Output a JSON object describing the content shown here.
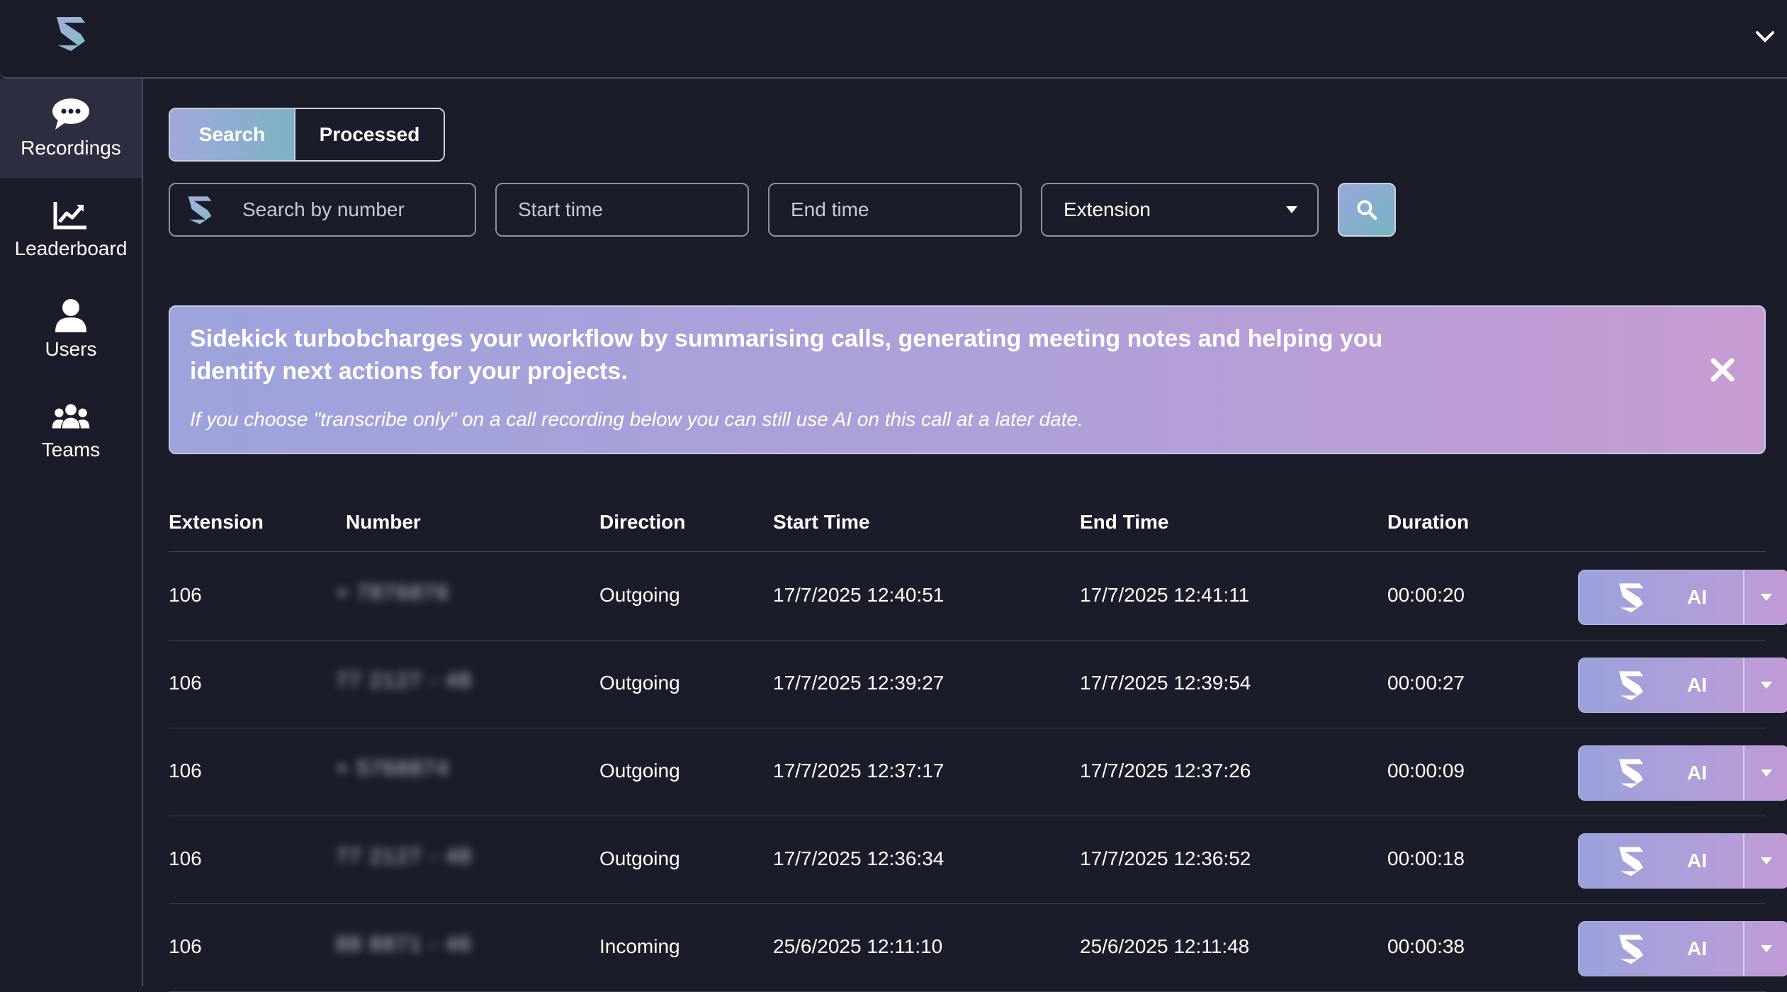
{
  "nav": {
    "items": [
      {
        "label": "Recordings",
        "icon": "chat-bubbles-icon",
        "active": true
      },
      {
        "label": "Leaderboard",
        "icon": "chart-line-icon",
        "active": false
      },
      {
        "label": "Users",
        "icon": "user-icon",
        "active": false
      },
      {
        "label": "Teams",
        "icon": "users-group-icon",
        "active": false
      }
    ]
  },
  "tabs": {
    "search": "Search",
    "processed": "Processed"
  },
  "filters": {
    "search_placeholder": "Search by number",
    "start_placeholder": "Start time",
    "end_placeholder": "End time",
    "extension_label": "Extension"
  },
  "banner": {
    "title": "Sidekick turbobcharges your workflow by summarising calls, generating meeting notes and helping you identify next actions for your projects.",
    "note": "If you choose \"transcribe only\" on a call recording below you can still use AI on this call at a later date."
  },
  "table": {
    "headers": {
      "extension": "Extension",
      "number": "Number",
      "direction": "Direction",
      "start": "Start Time",
      "end": "End Time",
      "duration": "Duration"
    },
    "ai_label": "AI",
    "rows": [
      {
        "extension": "106",
        "number": "+ 7876876",
        "direction": "Outgoing",
        "start": "17/7/2025 12:40:51",
        "end": "17/7/2025 12:41:11",
        "duration": "00:00:20"
      },
      {
        "extension": "106",
        "number": "77 2127 - 48",
        "direction": "Outgoing",
        "start": "17/7/2025 12:39:27",
        "end": "17/7/2025 12:39:54",
        "duration": "00:00:27"
      },
      {
        "extension": "106",
        "number": "+ 5768874",
        "direction": "Outgoing",
        "start": "17/7/2025 12:37:17",
        "end": "17/7/2025 12:37:26",
        "duration": "00:00:09"
      },
      {
        "extension": "106",
        "number": "77 2127 - 48",
        "direction": "Outgoing",
        "start": "17/7/2025 12:36:34",
        "end": "17/7/2025 12:36:52",
        "duration": "00:00:18"
      },
      {
        "extension": "106",
        "number": "88 8871 - 46",
        "direction": "Incoming",
        "start": "25/6/2025 12:11:10",
        "end": "25/6/2025 12:11:48",
        "duration": "00:00:38"
      }
    ]
  },
  "colors": {
    "background": "#1b1c2a",
    "accent_start": "#9da3dc",
    "accent_end": "#c89cd3",
    "teal": "#7db3c3"
  }
}
